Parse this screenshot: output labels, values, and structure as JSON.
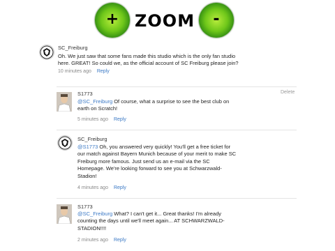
{
  "zoom": {
    "in_symbol": "+",
    "title": "ZOOM",
    "out_symbol": "-"
  },
  "comments": [
    {
      "author": "SC_Freiburg",
      "text_1": "Oh. We just saw that some fans made this studio which is the only fan studio",
      "text_2": "here. GREAT! So could we, as the official account of SC Freiburg please join?",
      "time": "10 minutes ago",
      "reply": "Reply"
    },
    {
      "author": "S1773",
      "delete": "Delete",
      "mention": "@SC_Freiburg",
      "text_1": " Of course, what a surprise to see the best club on",
      "text_2": "earth on Scratch!",
      "time": "5 minutes ago",
      "reply": "Reply"
    },
    {
      "author": "SC_Freiburg",
      "mention": "@S1773",
      "text_1": " Oh, you answered very quickly! You'll get a free ticket for",
      "text_2": "our match against Bayern Munich because of your merit to make SC",
      "text_3": "Freiburg more famous. Just send us an e-mail via the SC",
      "text_4": "Homepage. We're looking forward to see you at Schwarzwald-",
      "text_5": "Stadion!",
      "time": "4 minutes ago",
      "reply": "Reply"
    },
    {
      "author": "S1773",
      "mention": "@SC_Freiburg",
      "text_1": " What? I can't get it... Great thanks! I'm already",
      "text_2": "counting the days until we'll meet again... AT SCHWARZWALD-",
      "text_3": "STADION!!!!",
      "time": "2 minutes ago",
      "reply": "Reply"
    }
  ]
}
